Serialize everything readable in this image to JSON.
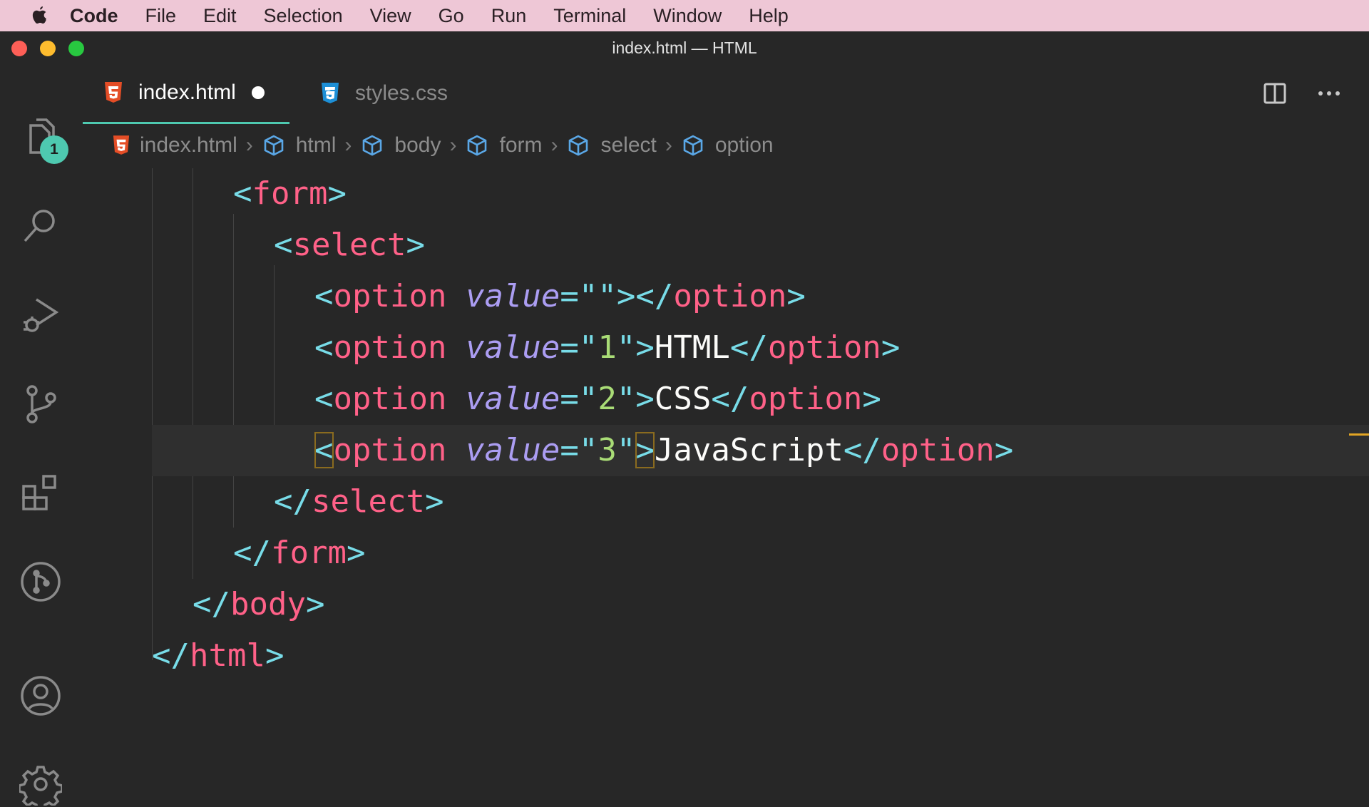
{
  "menubar": {
    "app": "Code",
    "items": [
      "File",
      "Edit",
      "Selection",
      "View",
      "Go",
      "Run",
      "Terminal",
      "Window",
      "Help"
    ]
  },
  "window": {
    "title": "index.html — HTML"
  },
  "activity_bar": {
    "explorer_badge": "1",
    "icons": [
      "files-icon",
      "search-icon",
      "run-debug-icon",
      "source-control-icon",
      "extensions-icon",
      "git-graph-icon",
      "account-icon",
      "gear-icon"
    ]
  },
  "tabs": [
    {
      "label": "index.html",
      "icon": "html5-icon",
      "active": true,
      "dirty": true
    },
    {
      "label": "styles.css",
      "icon": "css3-icon",
      "active": false,
      "dirty": false
    }
  ],
  "breadcrumb": [
    "index.html",
    "html",
    "body",
    "form",
    "select",
    "option"
  ],
  "code": {
    "current_line": 6,
    "lines": [
      [
        "<form>"
      ],
      [
        "<select>"
      ],
      [
        "<option ",
        "value",
        "=",
        "\"\"",
        "></option>"
      ],
      [
        "<option ",
        "value",
        "=",
        "\"1\"",
        ">",
        "HTML",
        "</option>"
      ],
      [
        "<option ",
        "value",
        "=",
        "\"2\"",
        ">",
        "CSS",
        "</option>"
      ],
      [
        "<option ",
        "value",
        "=",
        "\"3\"",
        ">",
        "JavaScript",
        "</option>"
      ],
      [
        "</select>"
      ],
      [
        "</form>"
      ],
      [
        "</body>"
      ],
      [
        "</html>"
      ]
    ]
  },
  "colors": {
    "menubar_bg": "#eec7d6",
    "editor_bg": "#272727",
    "tag": "#ff6188",
    "punctuation": "#78dce8",
    "attribute": "#ab9df2",
    "string": "#a9dc76",
    "text": "#fcfcfa",
    "accent": "#4ec9b0"
  }
}
